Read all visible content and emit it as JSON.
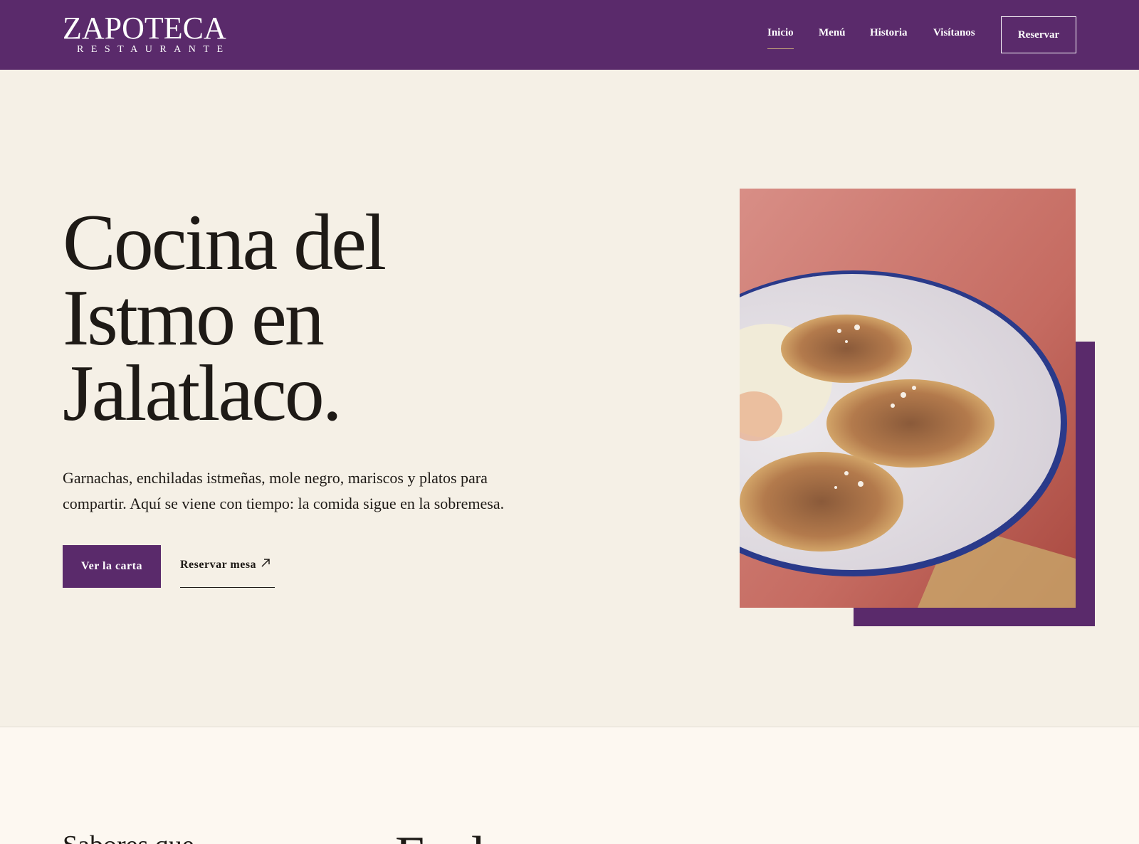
{
  "brand": {
    "name": "ZAPOTECA",
    "subtitle": "RESTAURANTE"
  },
  "nav": {
    "items": [
      {
        "label": "Inicio",
        "active": true
      },
      {
        "label": "Menú",
        "active": false
      },
      {
        "label": "Historia",
        "active": false
      },
      {
        "label": "Visítanos",
        "active": false
      }
    ],
    "cta_label": "Reservar"
  },
  "hero": {
    "title_lines": [
      "Cocina del",
      "Istmo en",
      "Jalatlaco."
    ],
    "description_line1": "Garnachas, enchiladas istmeñas, mole negro, mariscos y platos para",
    "description_line2": "compartir. Aquí se viene con tiempo: la comida sigue en la sobremesa.",
    "primary_button": "Ver la carta",
    "secondary_button": "Reservar mesa",
    "secondary_icon": "arrow-up-right-icon"
  },
  "next_section": {
    "heading_left": "Sabores que",
    "heading_mid": "En la mesa"
  },
  "colors": {
    "brand_purple": "#5a2a6b",
    "hero_bg": "#f5f0e6",
    "page_bg": "#fdf8f1",
    "text_dark": "#1e1a16",
    "nav_underline": "#c9a97a"
  }
}
